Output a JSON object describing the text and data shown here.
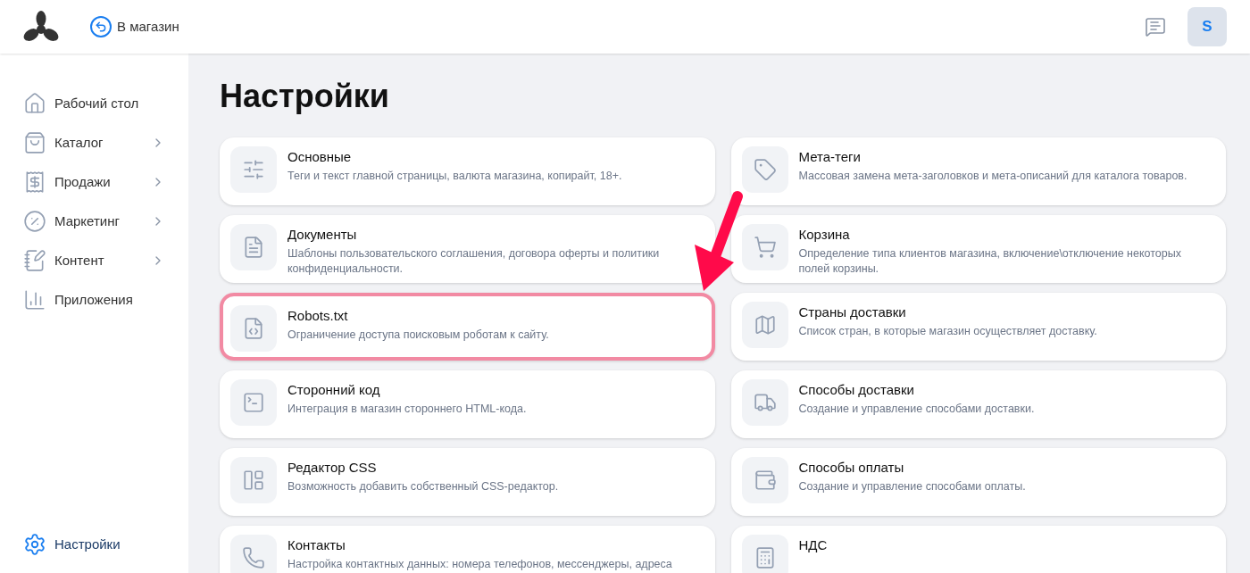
{
  "header": {
    "back_link": "В магазин",
    "avatar": "S"
  },
  "sidebar": {
    "items": [
      {
        "label": "Рабочий стол",
        "has_submenu": false,
        "selected": false
      },
      {
        "label": "Каталог",
        "has_submenu": true,
        "selected": false
      },
      {
        "label": "Продажи",
        "has_submenu": true,
        "selected": false
      },
      {
        "label": "Маркетинг",
        "has_submenu": true,
        "selected": false
      },
      {
        "label": "Контент",
        "has_submenu": true,
        "selected": false
      },
      {
        "label": "Приложения",
        "has_submenu": false,
        "selected": false
      }
    ],
    "bottom_item": {
      "label": "Настройки",
      "selected": true
    }
  },
  "page": {
    "title": "Настройки"
  },
  "cards_left": [
    {
      "title": "Основные",
      "description": "Теги и текст главной страницы, валюта магазина, копирайт, 18+.",
      "highlighted": false
    },
    {
      "title": "Документы",
      "description": "Шаблоны пользовательского соглашения, договора оферты и политики конфиденциальности.",
      "highlighted": false
    },
    {
      "title": "Robots.txt",
      "description": "Ограничение доступа поисковым роботам к сайту.",
      "highlighted": true
    },
    {
      "title": "Сторонний код",
      "description": "Интеграция в магазин стороннего HTML-кода.",
      "highlighted": false
    },
    {
      "title": "Редактор CSS",
      "description": "Возможность добавить собственный CSS-редактор.",
      "highlighted": false
    },
    {
      "title": "Контакты",
      "description": "Настройка контактных данных: номера телефонов, мессенджеры, адреса",
      "highlighted": false
    }
  ],
  "cards_right": [
    {
      "title": "Мета-теги",
      "description": "Массовая замена мета-заголовков и мета-описаний для каталога товаров.",
      "highlighted": false
    },
    {
      "title": "Корзина",
      "description": "Определение типа клиентов магазина, включение\\отключение некоторых полей корзины.",
      "highlighted": false
    },
    {
      "title": "Страны доставки",
      "description": "Список стран, в которые магазин осуществляет доставку.",
      "highlighted": false
    },
    {
      "title": "Способы доставки",
      "description": "Создание и управление способами доставки.",
      "highlighted": false
    },
    {
      "title": "Способы оплаты",
      "description": "Создание и управление способами оплаты.",
      "highlighted": false
    },
    {
      "title": "НДС",
      "highlighted": false
    }
  ]
}
